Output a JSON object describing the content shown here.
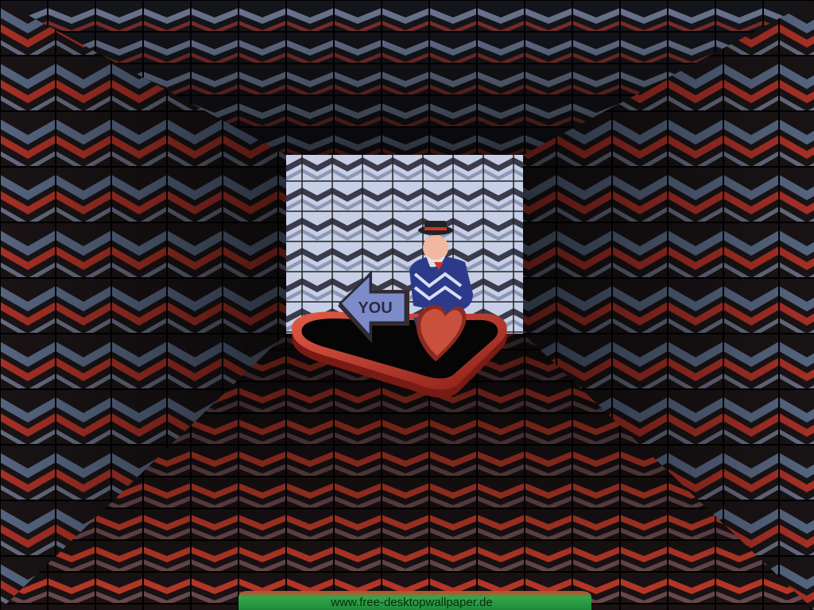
{
  "sign": {
    "text": "YOU"
  },
  "watermark": {
    "text": "www.free-desktopwallpaper.de"
  },
  "colors": {
    "tile_red": "#d8402c",
    "tile_dark": "#1a1416",
    "tile_steel": "#5a6a86",
    "back_wall": "#c6cfe6",
    "heart_red": "#c8372a",
    "watermark_green": "#2fa84a",
    "watermark_text": "#0a2a0f"
  }
}
